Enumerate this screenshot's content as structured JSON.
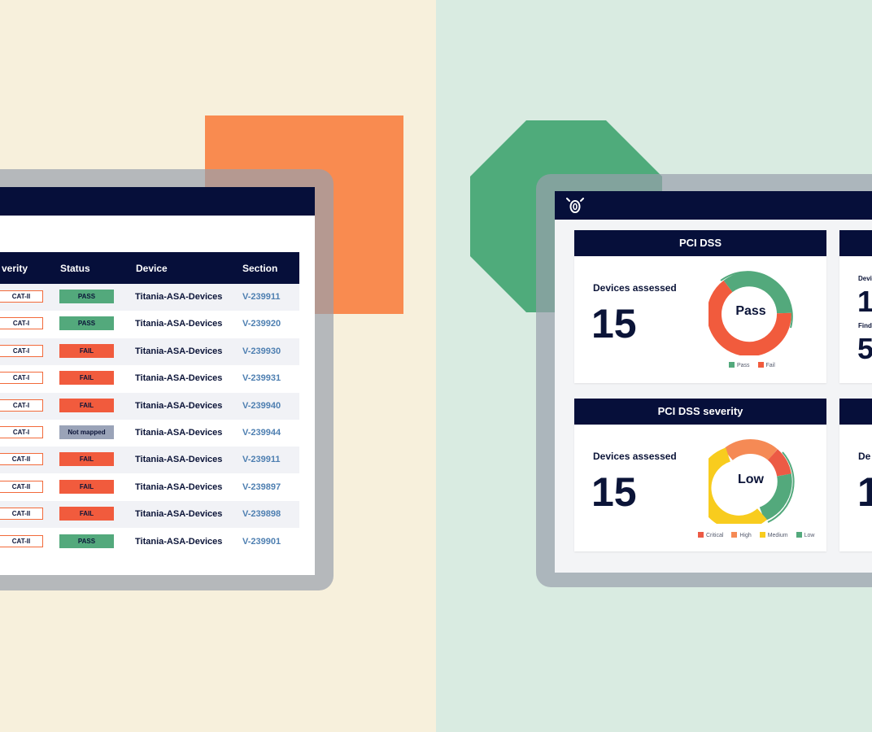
{
  "colors": {
    "navy": "#060f3a",
    "pass": "#53a97c",
    "fail": "#f15b3d",
    "not_mapped": "#9aa3b8",
    "link": "#4e7fb1",
    "critical": "#ec5a45",
    "high": "#f58a55",
    "medium": "#f8cc1e",
    "low": "#53a97c",
    "orange_accent": "#f98b50",
    "green_accent": "#4fab7b"
  },
  "table": {
    "headers": [
      "verity",
      "Status",
      "Device",
      "Section"
    ],
    "rows": [
      {
        "severity": "CAT-II",
        "status": "PASS",
        "device": "Titania-ASA-Devices",
        "section": "V-239911"
      },
      {
        "severity": "CAT-I",
        "status": "PASS",
        "device": "Titania-ASA-Devices",
        "section": "V-239920"
      },
      {
        "severity": "CAT-I",
        "status": "FAIL",
        "device": "Titania-ASA-Devices",
        "section": "V-239930"
      },
      {
        "severity": "CAT-I",
        "status": "FAIL",
        "device": "Titania-ASA-Devices",
        "section": "V-239931"
      },
      {
        "severity": "CAT-I",
        "status": "FAIL",
        "device": "Titania-ASA-Devices",
        "section": "V-239940"
      },
      {
        "severity": "CAT-I",
        "status": "Not mapped",
        "device": "Titania-ASA-Devices",
        "section": "V-239944"
      },
      {
        "severity": "CAT-II",
        "status": "FAIL",
        "device": "Titania-ASA-Devices",
        "section": "V-239911"
      },
      {
        "severity": "CAT-II",
        "status": "FAIL",
        "device": "Titania-ASA-Devices",
        "section": "V-239897"
      },
      {
        "severity": "CAT-II",
        "status": "FAIL",
        "device": "Titania-ASA-Devices",
        "section": "V-239898"
      },
      {
        "severity": "CAT-II",
        "status": "PASS",
        "device": "Titania-ASA-Devices",
        "section": "V-239901"
      }
    ]
  },
  "dashboard": {
    "logo_icon": "titania-owl-icon",
    "card1": {
      "title": "PCI DSS",
      "label": "Devices assessed",
      "value": "15",
      "center": "Pass",
      "legend": [
        "Pass",
        "Fail"
      ]
    },
    "card2": {
      "title": "PCI DSS severity",
      "label": "Devices assessed",
      "value": "15",
      "center": "Low",
      "legend": [
        "Critical",
        "High",
        "Medium",
        "Low"
      ]
    },
    "card3_partial": {
      "label1": "Devi",
      "value1": "1",
      "label2": "Find",
      "value2": "5"
    },
    "card4_partial": {
      "label": "De",
      "value": "1"
    }
  }
}
